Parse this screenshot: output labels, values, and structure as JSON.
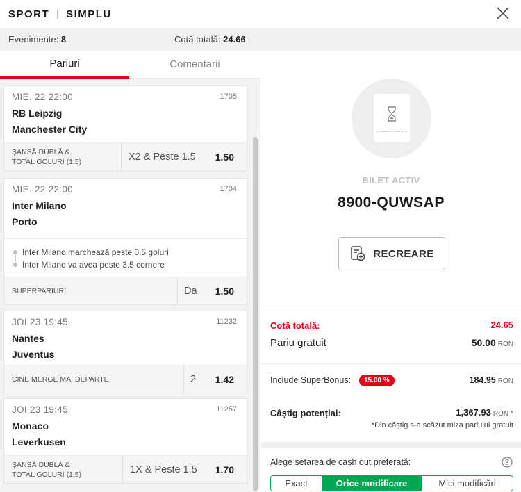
{
  "header": {
    "brand": "SPORT",
    "separator": "|",
    "mode": "SIMPLU"
  },
  "summary": {
    "events_label": "Evenimente:",
    "events_value": "8",
    "odds_label": "Cotă totală:",
    "odds_value": "24.66"
  },
  "tabs": [
    {
      "label": "Pariuri",
      "active": true
    },
    {
      "label": "Comentarii",
      "active": false
    }
  ],
  "bets": [
    {
      "date": "MIE. 22  22:00",
      "code": "1705",
      "home": "RB Leipzig",
      "away": "Manchester City",
      "market_line1": "ȘANSĂ DUBLĂ &",
      "market_line2": "TOTAL GOLURI (1.5)",
      "pick": "X2 & Peste 1.5",
      "odd": "1.50"
    },
    {
      "date": "MIE. 22  22:00",
      "code": "1704",
      "home": "Inter Milano",
      "away": "Porto",
      "sub_bets": [
        "Inter Milano marchează peste 0.5 goluri",
        "Inter Milano va avea peste 3.5 cornere"
      ],
      "market_line1": "SUPERPARIURI",
      "pick": "Da",
      "odd": "1.50"
    },
    {
      "date": "JOI 23  19:45",
      "code": "11232",
      "home": "Nantes",
      "away": "Juventus",
      "market_line1": "CINE MERGE MAI DEPARTE",
      "pick": "2",
      "odd": "1.42"
    },
    {
      "date": "JOI 23  19:45",
      "code": "11257",
      "home": "Monaco",
      "away": "Leverkusen",
      "market_line1": "ȘANSĂ DUBLĂ &",
      "market_line2": "TOTAL GOLURI (1.5)",
      "pick": "1X & Peste 1.5",
      "odd": "1.70"
    }
  ],
  "ticket": {
    "status": "BILET ACTIV",
    "code": "8900-QUWSAP",
    "recreate_label": "RECREARE"
  },
  "totals": {
    "odds_label": "Cotă totală:",
    "odds_value": "24.65",
    "stake_label": "Pariu gratuit",
    "stake_value": "50.00",
    "currency": "RON",
    "bonus_label": "Include SuperBonus:",
    "bonus_percent": "15.00 %",
    "bonus_value": "184.95",
    "win_label": "Câștig potențial:",
    "win_value": "1,367.93",
    "win_suffix": "*",
    "note": "*Din câștig s-a scăzut miza pariului gratuit"
  },
  "cashout": {
    "label": "Alege setarea de cash out preferată:",
    "options": [
      {
        "label": "Exact",
        "active": false
      },
      {
        "label": "Orice modificare",
        "active": true
      },
      {
        "label": "Mici modificări",
        "active": false
      }
    ]
  },
  "colors": {
    "accent": "#e2001a",
    "success": "#00a651"
  },
  "icons": [
    "close-icon",
    "hourglass-icon",
    "recreate-icon",
    "help-icon"
  ]
}
